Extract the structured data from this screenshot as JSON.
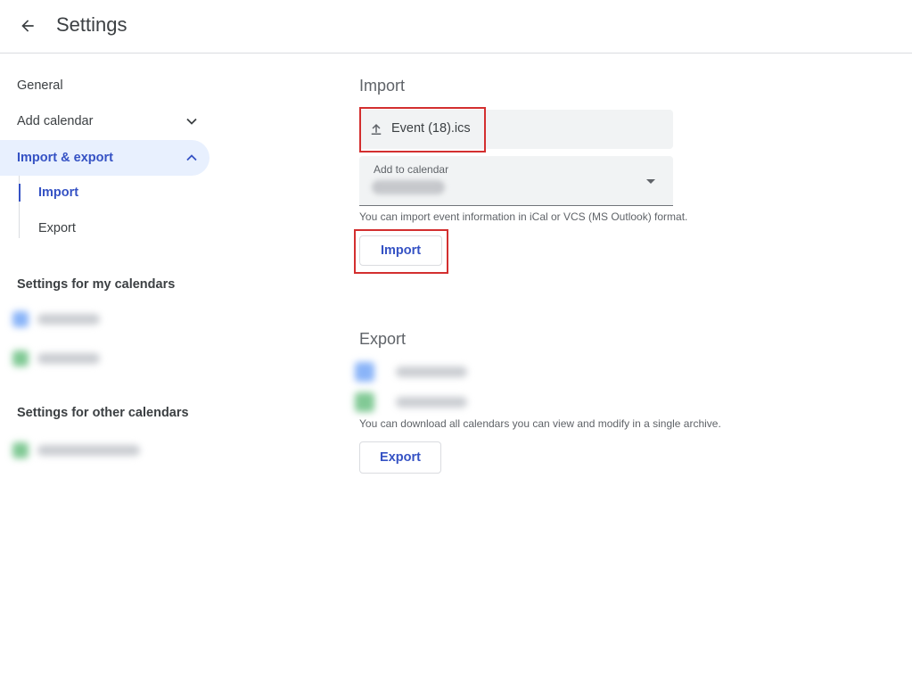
{
  "header": {
    "title": "Settings",
    "back_icon": "arrow-left-icon"
  },
  "sidebar": {
    "general": "General",
    "add_calendar": "Add calendar",
    "import_export": "Import & export",
    "import": "Import",
    "export": "Export",
    "my_calendars_heading": "Settings for my calendars",
    "other_calendars_heading": "Settings for other calendars",
    "my_calendars_colors": [
      "#8ab4f8",
      "#81c995"
    ],
    "other_calendars_colors": [
      "#81c995"
    ]
  },
  "main": {
    "import_heading": "Import",
    "file_name": "Event (18).ics",
    "add_to_calendar_label": "Add to calendar",
    "import_helper": "You can import event information in iCal or VCS (MS Outlook) format.",
    "import_button": "Import",
    "export_heading": "Export",
    "export_helper": "You can download all calendars you can view and modify in a single archive.",
    "export_button": "Export"
  },
  "colors": {
    "accent": "#3552c4",
    "highlight": "#d32f2f",
    "active_bg": "#e8f0fe"
  }
}
